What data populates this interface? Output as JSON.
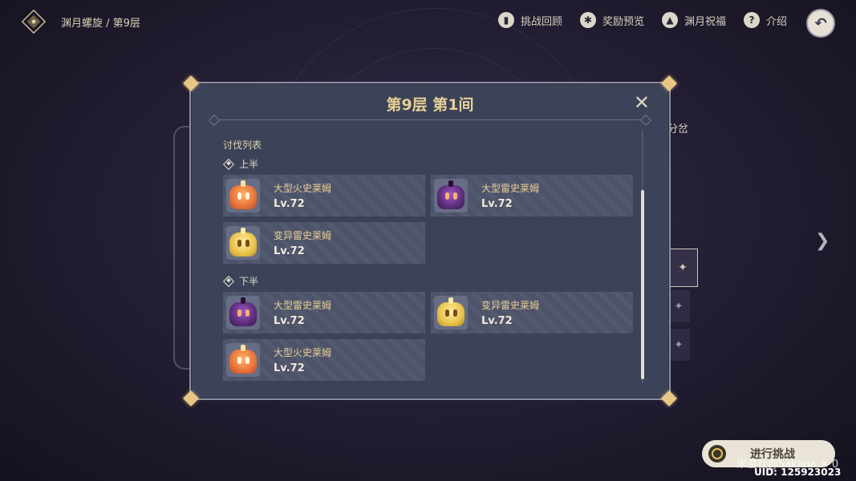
{
  "header": {
    "breadcrumb": "渊月螺旋 / 第9层",
    "actions": [
      {
        "label": "挑战回顾",
        "icon": "book-icon",
        "glyph": "▮"
      },
      {
        "label": "奖励预览",
        "icon": "star-gear-icon",
        "glyph": "✱"
      },
      {
        "label": "渊月祝福",
        "icon": "upgrade-arrow-icon",
        "glyph": "▲"
      },
      {
        "label": "介绍",
        "icon": "question-icon",
        "glyph": "?"
      }
    ],
    "back_icon": "back-arrow-icon"
  },
  "side": {
    "right_label": "分岔"
  },
  "modal": {
    "title": "第9层 第1间",
    "close_glyph": "✕",
    "section_label": "讨伐列表",
    "halves": [
      {
        "label": "上半",
        "enemies": [
          {
            "name": "大型火史莱姆",
            "level": "Lv.72",
            "type": "fire"
          },
          {
            "name": "大型雷史莱姆",
            "level": "Lv.72",
            "type": "electro"
          },
          {
            "name": "变异雷史莱姆",
            "level": "Lv.72",
            "type": "mutant"
          }
        ]
      },
      {
        "label": "下半",
        "enemies": [
          {
            "name": "大型雷史莱姆",
            "level": "Lv.72",
            "type": "electro"
          },
          {
            "name": "变异雷史莱姆",
            "level": "Lv.72",
            "type": "mutant"
          },
          {
            "name": "大型火史莱姆",
            "level": "Lv.72",
            "type": "fire"
          }
        ]
      }
    ]
  },
  "footer": {
    "challenge_label": "进行挑战",
    "uid": "UID: 125923023",
    "watermark": "米游社@Sakana × 0"
  },
  "colors": {
    "fire": "#e8743a",
    "electro": "#5b2d7a",
    "mutant": "#e8c24a",
    "title_gold": "#e6cf98"
  }
}
